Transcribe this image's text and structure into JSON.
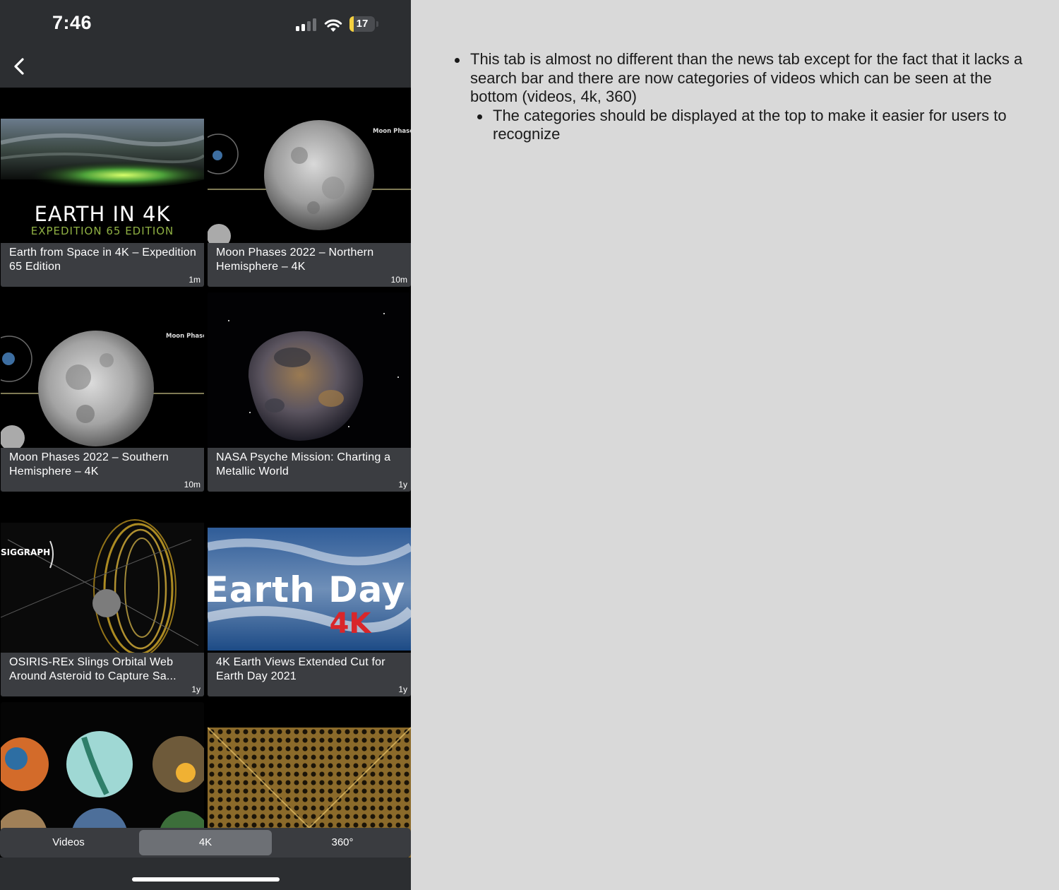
{
  "status_bar": {
    "time": "7:46",
    "battery_level": "17",
    "battery_fraction": 0.17,
    "signal_bars": 2,
    "signal_bars_total": 4
  },
  "nav": {
    "back_icon": "chevron-left-icon"
  },
  "videos": [
    {
      "title": "Earth from Space in 4K – Expedition 65 Edition",
      "age": "1m",
      "thumb_title": "EARTH IN 4K",
      "thumb_subtitle": "EXPEDITION 65 EDITION"
    },
    {
      "title": "Moon Phases 2022 – Northern Hemisphere – 4K",
      "age": "10m",
      "thumb_label": "Moon Phases"
    },
    {
      "title": "Moon Phases 2022 – Southern Hemisphere – 4K",
      "age": "10m",
      "thumb_label": "Moon Phases"
    },
    {
      "title": "NASA Psyche Mission: Charting a Metallic World",
      "age": "1y"
    },
    {
      "title": "OSIRIS-REx Slings Orbital Web Around Asteroid to Capture Sa...",
      "age": "1y",
      "thumb_label": "SIGGRAPH"
    },
    {
      "title": "4K Earth Views Extended Cut for Earth Day 2021",
      "age": "1y",
      "thumb_title": "Earth Day",
      "thumb_subtitle": "4K"
    }
  ],
  "categories": {
    "items": [
      "Videos",
      "4K",
      "360°"
    ],
    "selected": "4K"
  },
  "notes": {
    "main": "This tab is almost no different than the news tab except for the fact that it lacks a search bar and there are now categories of videos which can be seen at the bottom (videos, 4k, 360)",
    "sub": "The categories should be displayed at the top to make it easier for users to recognize"
  },
  "colors": {
    "phone_chrome": "#2c2e31",
    "caption_bg": "#3b3d41",
    "segment_selected": "#6d7075",
    "battery_accent": "#f4d03f",
    "notes_bg": "#d9d9d9"
  }
}
